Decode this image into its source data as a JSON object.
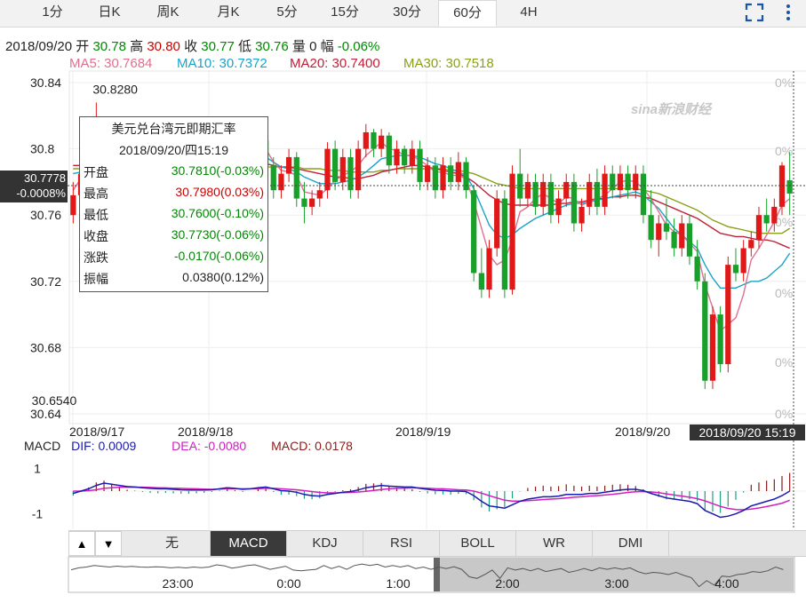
{
  "tabs": [
    {
      "label": "1分"
    },
    {
      "label": "日K"
    },
    {
      "label": "周K"
    },
    {
      "label": "月K"
    },
    {
      "label": "5分"
    },
    {
      "label": "15分"
    },
    {
      "label": "30分"
    },
    {
      "label": "60分"
    },
    {
      "label": "4H"
    }
  ],
  "active_tab": "60分",
  "icons": {
    "expand": "fullscreen-icon",
    "menu": "more-vertical-icon"
  },
  "quote": {
    "date": "2018/09/20",
    "open_label": "开",
    "open": "30.78",
    "high_label": "高",
    "high": "30.80",
    "close_label": "收",
    "close": "30.77",
    "low_label": "低",
    "low": "30.76",
    "volume_label": "量",
    "volume": "0",
    "change_label": "幅",
    "change": "-0.06%"
  },
  "ma": {
    "ma5": "MA5: 30.7684",
    "ma10": "MA10: 30.7372",
    "ma20": "MA20: 30.7400",
    "ma30": "MA30: 30.7518",
    "colors": {
      "ma5": "#e07090",
      "ma10": "#1aa3c8",
      "ma20": "#c0203a",
      "ma30": "#8aa018"
    }
  },
  "watermark": "sina新浪财经",
  "tooltip": {
    "title": "美元兑台湾元即期汇率",
    "datetime": "2018/09/20/四15:19",
    "rows": [
      {
        "label": "开盘",
        "value": "30.7810(-0.03%)",
        "color": "#008800"
      },
      {
        "label": "最高",
        "value": "30.7980(0.03%)",
        "color": "#cc0000"
      },
      {
        "label": "最低",
        "value": "30.7600(-0.10%)",
        "color": "#008800"
      },
      {
        "label": "收盘",
        "value": "30.7730(-0.06%)",
        "color": "#008800"
      },
      {
        "label": "涨跌",
        "value": "-0.0170(-0.06%)",
        "color": "#008800"
      },
      {
        "label": "振幅",
        "value": "0.0380(0.12%)",
        "color": "#222222"
      }
    ]
  },
  "crosshair": {
    "price": "30.7778",
    "pct": "-0.0008%",
    "time_label": "2018/09/20 15:19",
    "value": 30.7778
  },
  "macd": {
    "title": "MACD",
    "dif": "DIF: 0.0009",
    "dea": "DEA: -0.0080",
    "macd": "MACD: 0.0178",
    "colors": {
      "dif": "#1a1ab0",
      "dea": "#d020c0",
      "up": "#8b1a1a",
      "down": "#18a080"
    }
  },
  "bottom_tabs": [
    {
      "label": "无"
    },
    {
      "label": "MACD"
    },
    {
      "label": "KDJ"
    },
    {
      "label": "RSI"
    },
    {
      "label": "BOLL"
    },
    {
      "label": "WR"
    },
    {
      "label": "DMI"
    }
  ],
  "active_bottom_tab": "MACD",
  "nav_arrows": {
    "up": "▲",
    "down": "▼"
  },
  "navigator_labels": [
    "23:00",
    "0:00",
    "1:00",
    "2:00",
    "3:00",
    "4:00"
  ],
  "chart_data": {
    "type": "candlestick",
    "title": "美元兑台湾元即期汇率",
    "ylim": [
      30.64,
      30.84
    ],
    "y_ticks": [
      "30.84",
      "30.8",
      "30.76",
      "30.72",
      "30.68",
      "30.64"
    ],
    "right_ticks": [
      "0%",
      "0%",
      "0%",
      "0%",
      "0%",
      "0%"
    ],
    "x_labels": [
      "2018/9/17",
      "2018/9/18",
      "2018/9/19",
      "2018/9/20"
    ],
    "annotations": {
      "max": "30.8280",
      "min": "30.6540",
      "max_value": 30.828,
      "min_value": 30.654
    },
    "candles": [
      [
        30.76,
        30.772,
        30.755,
        30.78
      ],
      [
        30.772,
        30.785,
        30.768,
        30.795
      ],
      [
        30.785,
        30.79,
        30.78,
        30.81
      ],
      [
        30.79,
        30.8,
        30.785,
        30.828
      ],
      [
        30.8,
        30.795,
        30.788,
        30.805
      ],
      [
        30.795,
        30.79,
        30.785,
        30.8
      ],
      [
        30.79,
        30.796,
        30.785,
        30.802
      ],
      [
        30.796,
        30.792,
        30.786,
        30.8
      ],
      [
        30.792,
        30.794,
        30.788,
        30.8
      ],
      [
        30.794,
        30.79,
        30.784,
        30.798
      ],
      [
        30.79,
        30.788,
        30.782,
        30.796
      ],
      [
        30.788,
        30.792,
        30.784,
        30.798
      ],
      [
        30.792,
        30.79,
        30.782,
        30.8
      ],
      [
        30.79,
        30.785,
        30.778,
        30.795
      ],
      [
        30.785,
        30.788,
        30.78,
        30.794
      ],
      [
        30.788,
        30.784,
        30.776,
        30.792
      ],
      [
        30.784,
        30.79,
        30.78,
        30.796
      ],
      [
        30.79,
        30.786,
        30.78,
        30.795
      ],
      [
        30.786,
        30.79,
        30.782,
        30.798
      ],
      [
        30.79,
        30.805,
        30.787,
        30.808
      ],
      [
        30.805,
        30.798,
        30.79,
        30.808
      ],
      [
        30.798,
        30.783,
        30.78,
        30.8
      ],
      [
        30.783,
        30.79,
        30.778,
        30.795
      ],
      [
        30.79,
        30.8,
        30.785,
        30.805
      ],
      [
        30.8,
        30.805,
        30.795,
        30.81
      ],
      [
        30.805,
        30.79,
        30.785,
        30.808
      ],
      [
        30.79,
        30.775,
        30.77,
        30.795
      ],
      [
        30.775,
        30.785,
        30.77,
        30.79
      ],
      [
        30.785,
        30.795,
        30.78,
        30.8
      ],
      [
        30.795,
        30.77,
        30.765,
        30.798
      ],
      [
        30.77,
        30.765,
        30.755,
        30.78
      ],
      [
        30.765,
        30.77,
        30.76,
        30.775
      ],
      [
        30.77,
        30.775,
        30.765,
        30.78
      ],
      [
        30.775,
        30.8,
        30.77,
        30.804
      ],
      [
        30.8,
        30.78,
        30.775,
        30.805
      ],
      [
        30.78,
        30.795,
        30.775,
        30.8
      ],
      [
        30.795,
        30.775,
        30.77,
        30.8
      ],
      [
        30.775,
        30.8,
        30.77,
        30.805
      ],
      [
        30.8,
        30.81,
        30.795,
        30.815
      ],
      [
        30.81,
        30.8,
        30.795,
        30.812
      ],
      [
        30.8,
        30.808,
        30.795,
        30.812
      ],
      [
        30.808,
        30.79,
        30.785,
        30.81
      ],
      [
        30.79,
        30.8,
        30.785,
        30.805
      ],
      [
        30.8,
        30.79,
        30.785,
        30.802
      ],
      [
        30.79,
        30.8,
        30.785,
        30.805
      ],
      [
        30.8,
        30.78,
        30.775,
        30.805
      ],
      [
        30.78,
        30.79,
        30.775,
        30.795
      ],
      [
        30.79,
        30.775,
        30.77,
        30.795
      ],
      [
        30.775,
        30.79,
        30.77,
        30.795
      ],
      [
        30.79,
        30.78,
        30.775,
        30.795
      ],
      [
        30.78,
        30.792,
        30.775,
        30.798
      ],
      [
        30.792,
        30.775,
        30.77,
        30.795
      ],
      [
        30.775,
        30.725,
        30.72,
        30.778
      ],
      [
        30.725,
        30.715,
        30.71,
        30.74
      ],
      [
        30.715,
        30.74,
        30.71,
        30.745
      ],
      [
        30.74,
        30.77,
        30.735,
        30.775
      ],
      [
        30.77,
        30.715,
        30.71,
        30.775
      ],
      [
        30.715,
        30.785,
        30.712,
        30.79
      ],
      [
        30.785,
        30.77,
        30.765,
        30.8
      ],
      [
        30.77,
        30.78,
        30.765,
        30.785
      ],
      [
        30.78,
        30.765,
        30.76,
        30.785
      ],
      [
        30.765,
        30.78,
        30.76,
        30.785
      ],
      [
        30.78,
        30.76,
        30.755,
        30.785
      ],
      [
        30.76,
        30.77,
        30.755,
        30.775
      ],
      [
        30.77,
        30.78,
        30.765,
        30.785
      ],
      [
        30.78,
        30.755,
        30.75,
        30.785
      ],
      [
        30.755,
        30.765,
        30.75,
        30.77
      ],
      [
        30.765,
        30.78,
        30.76,
        30.785
      ],
      [
        30.78,
        30.765,
        30.76,
        30.788
      ],
      [
        30.765,
        30.785,
        30.76,
        30.79
      ],
      [
        30.785,
        30.775,
        30.77,
        30.79
      ],
      [
        30.775,
        30.785,
        30.77,
        30.79
      ],
      [
        30.785,
        30.775,
        30.77,
        30.79
      ],
      [
        30.775,
        30.785,
        30.77,
        30.79
      ],
      [
        30.785,
        30.76,
        30.755,
        30.79
      ],
      [
        30.76,
        30.745,
        30.74,
        30.775
      ],
      [
        30.745,
        30.755,
        30.735,
        30.76
      ],
      [
        30.755,
        30.75,
        30.745,
        30.77
      ],
      [
        30.75,
        30.74,
        30.735,
        30.758
      ],
      [
        30.74,
        30.755,
        30.735,
        30.76
      ],
      [
        30.755,
        30.735,
        30.73,
        30.76
      ],
      [
        30.735,
        30.72,
        30.715,
        30.745
      ],
      [
        30.72,
        30.66,
        30.655,
        30.725
      ],
      [
        30.66,
        30.7,
        30.655,
        30.705
      ],
      [
        30.7,
        30.67,
        30.665,
        30.705
      ],
      [
        30.67,
        30.73,
        30.665,
        30.735
      ],
      [
        30.73,
        30.725,
        30.72,
        30.74
      ],
      [
        30.725,
        30.74,
        30.72,
        30.745
      ],
      [
        30.74,
        30.745,
        30.735,
        30.75
      ],
      [
        30.745,
        30.76,
        30.74,
        30.765
      ],
      [
        30.76,
        30.755,
        30.75,
        30.77
      ],
      [
        30.755,
        30.765,
        30.75,
        30.77
      ],
      [
        30.765,
        30.79,
        30.76,
        30.792
      ],
      [
        30.781,
        30.773,
        30.76,
        30.798
      ]
    ],
    "ma_series": {
      "ma5": [
        30.775,
        30.782,
        30.79,
        30.8,
        30.81,
        30.8,
        30.795,
        30.794,
        30.793,
        30.792,
        30.79,
        30.789,
        30.79,
        30.788,
        30.787,
        30.786,
        30.787,
        30.787,
        30.788,
        30.793,
        30.797,
        30.794,
        30.79,
        30.792,
        30.796,
        30.8,
        30.792,
        30.787,
        30.786,
        30.784,
        30.774,
        30.773,
        30.772,
        30.776,
        30.781,
        30.784,
        30.786,
        30.79,
        30.796,
        30.8,
        30.804,
        30.8,
        30.799,
        30.796,
        30.796,
        30.793,
        30.79,
        30.786,
        30.786,
        30.784,
        30.784,
        30.782,
        30.768,
        30.752,
        30.736,
        30.73,
        30.733,
        30.745,
        30.762,
        30.765,
        30.77,
        30.773,
        30.77,
        30.767,
        30.771,
        30.77,
        30.766,
        30.768,
        30.77,
        30.772,
        30.776,
        30.78,
        30.781,
        30.78,
        30.776,
        30.77,
        30.762,
        30.754,
        30.75,
        30.748,
        30.743,
        30.738,
        30.718,
        30.704,
        30.69,
        30.694,
        30.698,
        30.712,
        30.733,
        30.74,
        30.748,
        30.756,
        30.766,
        30.77
      ],
      "ma10": [
        30.785,
        30.786,
        30.787,
        30.79,
        30.792,
        30.793,
        30.794,
        30.793,
        30.792,
        30.791,
        30.79,
        30.789,
        30.789,
        30.788,
        30.788,
        30.787,
        30.787,
        30.787,
        30.787,
        30.789,
        30.791,
        30.791,
        30.79,
        30.791,
        30.793,
        30.795,
        30.792,
        30.789,
        30.788,
        30.786,
        30.783,
        30.781,
        30.779,
        30.779,
        30.779,
        30.78,
        30.781,
        30.783,
        30.786,
        30.79,
        30.794,
        30.795,
        30.796,
        30.796,
        30.796,
        30.795,
        30.793,
        30.791,
        30.79,
        30.788,
        30.786,
        30.784,
        30.776,
        30.765,
        30.754,
        30.748,
        30.746,
        30.748,
        30.752,
        30.755,
        30.758,
        30.76,
        30.762,
        30.764,
        30.766,
        30.767,
        30.767,
        30.768,
        30.769,
        30.77,
        30.771,
        30.772,
        30.773,
        30.774,
        30.772,
        30.768,
        30.764,
        30.758,
        30.752,
        30.748,
        30.744,
        30.74,
        30.73,
        30.722,
        30.716,
        30.716,
        30.716,
        30.718,
        30.72,
        30.72,
        30.722,
        30.726,
        30.73,
        30.737
      ],
      "ma20": [
        30.79,
        30.79,
        30.79,
        30.791,
        30.791,
        30.792,
        30.792,
        30.792,
        30.792,
        30.792,
        30.791,
        30.791,
        30.791,
        30.79,
        30.79,
        30.79,
        30.789,
        30.789,
        30.789,
        30.789,
        30.79,
        30.79,
        30.79,
        30.79,
        30.79,
        30.791,
        30.79,
        30.789,
        30.789,
        30.788,
        30.787,
        30.786,
        30.785,
        30.784,
        30.783,
        30.783,
        30.782,
        30.782,
        30.783,
        30.784,
        30.786,
        30.787,
        30.788,
        30.789,
        30.79,
        30.79,
        30.789,
        30.788,
        30.787,
        30.786,
        30.785,
        30.783,
        30.78,
        30.776,
        30.772,
        30.769,
        30.767,
        30.766,
        30.766,
        30.766,
        30.766,
        30.766,
        30.766,
        30.767,
        30.767,
        30.768,
        30.768,
        30.769,
        30.77,
        30.77,
        30.771,
        30.771,
        30.772,
        30.772,
        30.771,
        30.77,
        30.768,
        30.766,
        30.764,
        30.762,
        30.76,
        30.758,
        30.755,
        30.752,
        30.749,
        30.748,
        30.747,
        30.747,
        30.746,
        30.745,
        30.745,
        30.744,
        30.742,
        30.74
      ],
      "ma30": [
        30.788,
        30.788,
        30.788,
        30.788,
        30.789,
        30.789,
        30.789,
        30.789,
        30.789,
        30.789,
        30.789,
        30.789,
        30.789,
        30.789,
        30.789,
        30.789,
        30.789,
        30.789,
        30.789,
        30.789,
        30.789,
        30.789,
        30.789,
        30.789,
        30.789,
        30.789,
        30.789,
        30.789,
        30.789,
        30.789,
        30.788,
        30.788,
        30.788,
        30.787,
        30.787,
        30.787,
        30.786,
        30.786,
        30.786,
        30.786,
        30.787,
        30.787,
        30.788,
        30.788,
        30.788,
        30.788,
        30.788,
        30.788,
        30.788,
        30.787,
        30.787,
        30.786,
        30.785,
        30.783,
        30.781,
        30.779,
        30.778,
        30.777,
        30.776,
        30.776,
        30.776,
        30.776,
        30.776,
        30.776,
        30.776,
        30.776,
        30.776,
        30.776,
        30.776,
        30.776,
        30.776,
        30.776,
        30.776,
        30.776,
        30.775,
        30.774,
        30.773,
        30.771,
        30.769,
        30.767,
        30.765,
        30.763,
        30.76,
        30.757,
        30.755,
        30.753,
        30.752,
        30.751,
        30.75,
        30.749,
        30.749,
        30.749,
        30.749,
        30.752
      ]
    },
    "macd_ylim": [
      -1.6,
      1.6
    ],
    "macd_ticks": [
      "1",
      "-1"
    ],
    "macd_series": {
      "dif": [
        -0.1,
        0.0,
        0.1,
        0.25,
        0.35,
        0.3,
        0.25,
        0.2,
        0.18,
        0.15,
        0.12,
        0.1,
        0.1,
        0.08,
        0.06,
        0.05,
        0.05,
        0.05,
        0.06,
        0.1,
        0.15,
        0.12,
        0.08,
        0.1,
        0.15,
        0.18,
        0.1,
        0.02,
        0.0,
        -0.05,
        -0.15,
        -0.2,
        -0.22,
        -0.15,
        -0.1,
        -0.05,
        -0.02,
        0.05,
        0.15,
        0.2,
        0.25,
        0.22,
        0.2,
        0.18,
        0.18,
        0.12,
        0.08,
        0.04,
        0.03,
        0.0,
        0.0,
        -0.02,
        -0.2,
        -0.45,
        -0.65,
        -0.7,
        -0.75,
        -0.6,
        -0.45,
        -0.35,
        -0.3,
        -0.25,
        -0.25,
        -0.22,
        -0.15,
        -0.15,
        -0.15,
        -0.1,
        -0.1,
        -0.05,
        0.0,
        0.05,
        0.08,
        0.08,
        0.02,
        -0.1,
        -0.2,
        -0.3,
        -0.35,
        -0.4,
        -0.45,
        -0.55,
        -0.85,
        -1.0,
        -1.15,
        -1.1,
        -1.0,
        -0.85,
        -0.65,
        -0.55,
        -0.45,
        -0.35,
        -0.2,
        0.0
      ],
      "dea": [
        0.0,
        0.0,
        0.02,
        0.06,
        0.12,
        0.15,
        0.17,
        0.17,
        0.17,
        0.17,
        0.16,
        0.15,
        0.14,
        0.13,
        0.12,
        0.11,
        0.1,
        0.09,
        0.08,
        0.09,
        0.1,
        0.1,
        0.1,
        0.1,
        0.11,
        0.12,
        0.12,
        0.1,
        0.08,
        0.06,
        0.02,
        -0.02,
        -0.06,
        -0.08,
        -0.08,
        -0.07,
        -0.06,
        -0.04,
        -0.01,
        0.03,
        0.07,
        0.1,
        0.12,
        0.13,
        0.14,
        0.14,
        0.13,
        0.11,
        0.1,
        0.08,
        0.06,
        0.05,
        0.0,
        -0.09,
        -0.2,
        -0.3,
        -0.4,
        -0.44,
        -0.44,
        -0.42,
        -0.4,
        -0.37,
        -0.35,
        -0.33,
        -0.3,
        -0.27,
        -0.25,
        -0.22,
        -0.2,
        -0.17,
        -0.14,
        -0.1,
        -0.06,
        -0.03,
        -0.02,
        -0.04,
        -0.07,
        -0.12,
        -0.17,
        -0.22,
        -0.27,
        -0.33,
        -0.43,
        -0.55,
        -0.67,
        -0.76,
        -0.81,
        -0.82,
        -0.79,
        -0.74,
        -0.68,
        -0.61,
        -0.53,
        -0.4
      ]
    }
  }
}
